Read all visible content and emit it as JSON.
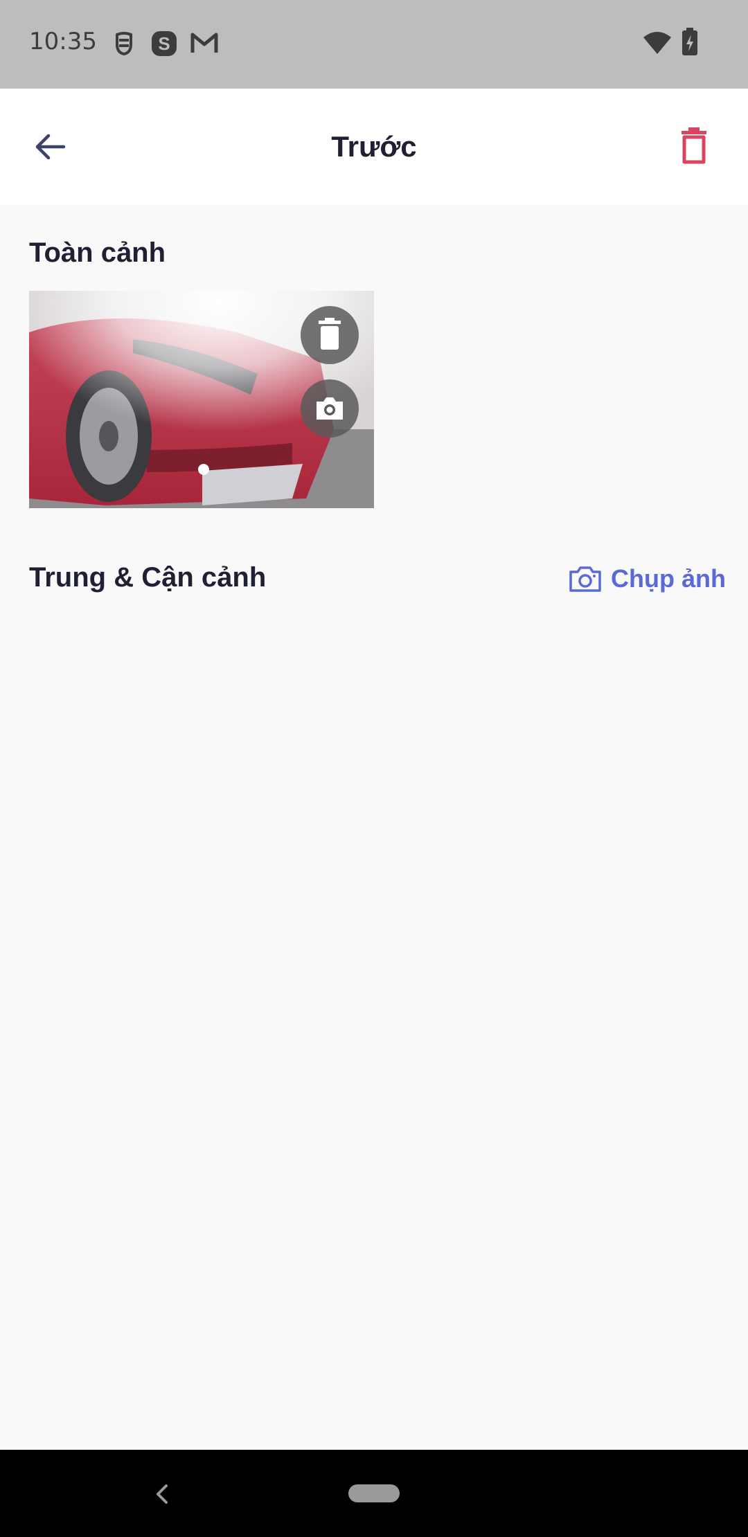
{
  "status_bar": {
    "time": "10:35",
    "notification_icons": [
      "face-mask-icon",
      "skype-icon",
      "gmail-icon"
    ],
    "system_icons": [
      "wifi-icon",
      "battery-charging-icon"
    ]
  },
  "app_bar": {
    "title": "Trước",
    "back_icon": "arrow-left-icon",
    "delete_icon": "trash-icon",
    "delete_color": "#d9455f"
  },
  "sections": {
    "overview": {
      "title": "Toàn cảnh",
      "photo": {
        "alt": "",
        "actions": [
          "trash-icon",
          "camera-icon"
        ]
      }
    },
    "closeup": {
      "title": "Trung & Cận cảnh",
      "capture_label": "Chụp ảnh",
      "accent_color": "#5b69d6"
    }
  },
  "nav_bar": {
    "back_icon": "chevron-left-icon",
    "home_icon": "home-pill-icon"
  }
}
